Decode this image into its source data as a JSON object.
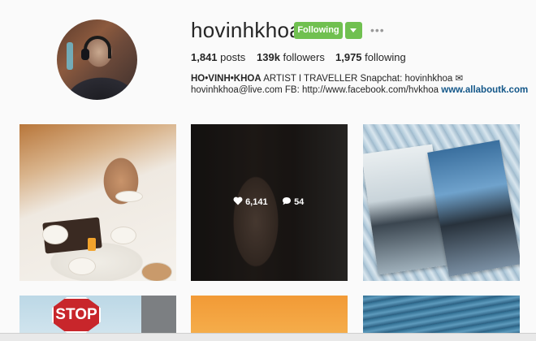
{
  "profile": {
    "username": "hovinhkhoa",
    "follow_label": "Following",
    "more_label": "•••",
    "stats": {
      "posts_value": "1,841",
      "posts_label": "posts",
      "followers_value": "139k",
      "followers_label": "followers",
      "following_value": "1,975",
      "following_label": "following"
    },
    "bio": {
      "name": "HO•VINH•KHOA",
      "line1_rest": " ARTIST I TRAVELLER  Snapchat: hovinhkhoa ✉",
      "line2_text": "hovinhkhoa@live.com FB: http://www.facebook.com/hvkhoa ",
      "website": "www.allaboutk.com"
    }
  },
  "posts": [
    {
      "label": "post-breakfast-in-bed"
    },
    {
      "label": "post-dark-portrait",
      "likes": "6,141",
      "comments": "54"
    },
    {
      "label": "post-magazine-spread"
    },
    {
      "label": "post-stop-sign",
      "sign_text": "STOP"
    },
    {
      "label": "post-orange"
    },
    {
      "label": "post-water"
    }
  ],
  "colors": {
    "follow_green": "#70c050",
    "link_blue": "#125688",
    "text": "#262626",
    "background": "#fafafa"
  }
}
